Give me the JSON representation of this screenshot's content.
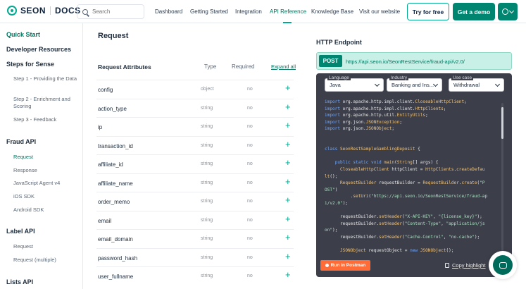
{
  "header": {
    "logo_brand": "SEON",
    "logo_docs": "DOCS",
    "search_placeholder": "Search",
    "nav": [
      {
        "label": "Dashboard"
      },
      {
        "label": "Getting Started"
      },
      {
        "label": "Integration"
      },
      {
        "label": "API Reference"
      },
      {
        "label": "Knowledge Base"
      },
      {
        "label": "Visit our website"
      }
    ],
    "active_nav": "API Reference",
    "try_label": "Try for free",
    "demo_label": "Get a demo"
  },
  "sidebar": {
    "quick_start": "Quick Start",
    "developer_resources": "Developer Resources",
    "steps_heading": "Steps for Sense",
    "steps": [
      "Step 1 - Providing the Data",
      "Step 2 - Enrichment and Scoring",
      "Step 3 - Feedback"
    ],
    "fraud_api_heading": "Fraud API",
    "fraud_items": [
      "Request",
      "Response",
      "JavaScript Agent v4",
      "iOS SDK",
      "Android SDK"
    ],
    "label_api_heading": "Label API",
    "label_items": [
      "Request",
      "Request (multiple)"
    ],
    "lists_api_heading": "Lists API"
  },
  "main": {
    "title": "Request",
    "attributes_heading": "Request Attributes",
    "type_heading": "Type",
    "required_heading": "Required",
    "expand_all": "Expand all",
    "rows": [
      {
        "name": "config",
        "type": "object",
        "required": "no"
      },
      {
        "name": "action_type",
        "type": "string",
        "required": "no"
      },
      {
        "name": "ip",
        "type": "string",
        "required": "no"
      },
      {
        "name": "transaction_id",
        "type": "string",
        "required": "no"
      },
      {
        "name": "affiliate_id",
        "type": "string",
        "required": "no"
      },
      {
        "name": "affiliate_name",
        "type": "string",
        "required": "no"
      },
      {
        "name": "order_memo",
        "type": "string",
        "required": "no"
      },
      {
        "name": "email",
        "type": "string",
        "required": "no"
      },
      {
        "name": "email_domain",
        "type": "string",
        "required": "no"
      },
      {
        "name": "password_hash",
        "type": "string",
        "required": "no"
      },
      {
        "name": "user_fullname",
        "type": "string",
        "required": "no"
      }
    ]
  },
  "endpoint": {
    "heading": "HTTP Endpoint",
    "method": "POST",
    "url": "https://api.seon.io/SeonRestService/fraud-api/v2.0/"
  },
  "code_panel": {
    "language_label": "Language",
    "language_value": "Java",
    "industry_label": "Industry",
    "industry_value": "Banking and Ins...",
    "usecase_label": "Use case",
    "usecase_value": "Withdrawal",
    "run_label": "Run in Postman",
    "copy_label": "Copy highlight"
  },
  "colors": {
    "accent": "#00a98f",
    "accent_dark": "#008570",
    "code_bg": "#3c3e49",
    "postman": "#ff6c37"
  }
}
